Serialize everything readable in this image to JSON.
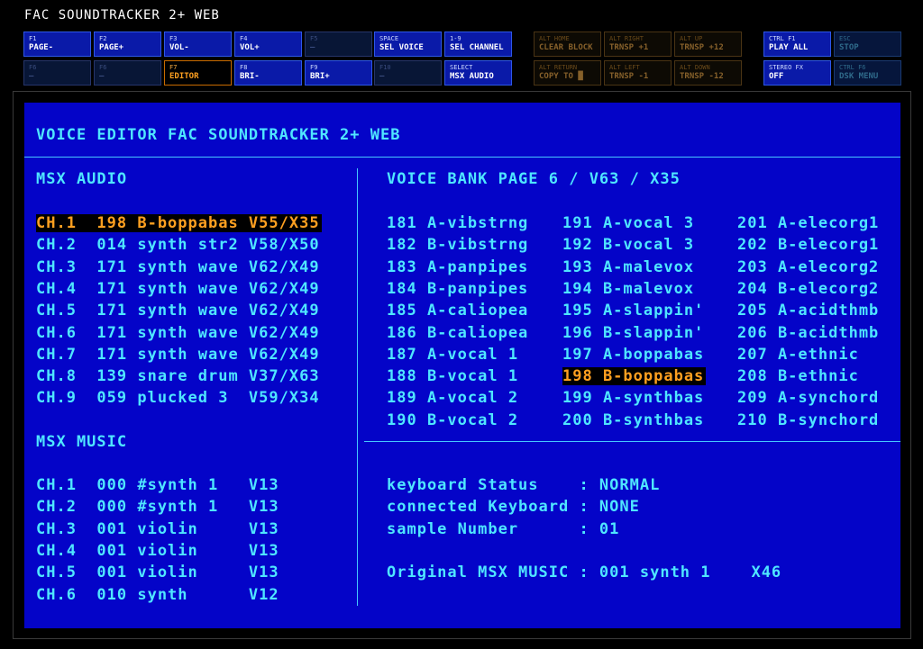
{
  "app_title": "FAC SOUNDTRACKER 2+ WEB",
  "keys_row1": [
    {
      "key": "F1",
      "label": "PAGE-"
    },
    {
      "key": "F2",
      "label": "PAGE+"
    },
    {
      "key": "F3",
      "label": "VOL-"
    },
    {
      "key": "F4",
      "label": "VOL+"
    },
    {
      "key": "F5",
      "label": "—"
    },
    {
      "key": "SPACE",
      "label": "SEL VOICE"
    },
    {
      "key": "1-9",
      "label": "SEL CHANNEL"
    },
    {
      "key": "ALT HOME",
      "label": "CLEAR BLOCK"
    },
    {
      "key": "ALT RIGHT",
      "label": "TRNSP +1"
    },
    {
      "key": "ALT UP",
      "label": "TRNSP +12"
    },
    {
      "key": "CTRL F1",
      "label": "PLAY ALL"
    },
    {
      "key": "ESC",
      "label": "STOP"
    }
  ],
  "keys_row2": [
    {
      "key": "F6",
      "label": "—"
    },
    {
      "key": "F6",
      "label": "—"
    },
    {
      "key": "F7",
      "label": "EDITOR"
    },
    {
      "key": "F8",
      "label": "BRI-"
    },
    {
      "key": "F9",
      "label": "BRI+"
    },
    {
      "key": "F10",
      "label": "—"
    },
    {
      "key": "SELECT",
      "label": "MSX AUDIO"
    },
    {
      "key": "ALT RETURN",
      "label": "COPY TO █"
    },
    {
      "key": "ALT LEFT",
      "label": "TRNSP -1"
    },
    {
      "key": "ALT DOWN",
      "label": "TRNSP -12"
    },
    {
      "key": "STEREO FX",
      "label": "OFF"
    },
    {
      "key": "CTRL F6",
      "label": "DSK MENU"
    }
  ],
  "editor": {
    "title": "VOICE EDITOR FAC SOUNDTRACKER 2+ WEB",
    "msx_audio": {
      "heading": "MSX AUDIO",
      "selected_index": 0,
      "channels": [
        "CH.1  198 B-boppabas V55/X35",
        "CH.2  014 synth str2 V58/X50",
        "CH.3  171 synth wave V62/X49",
        "CH.4  171 synth wave V62/X49",
        "CH.5  171 synth wave V62/X49",
        "CH.6  171 synth wave V62/X49",
        "CH.7  171 synth wave V62/X49",
        "CH.8  139 snare drum V37/X63",
        "CH.9  059 plucked 3  V59/X34"
      ]
    },
    "msx_music": {
      "heading": "MSX MUSIC",
      "channels": [
        "CH.1  000 #synth 1   V13",
        "CH.2  000 #synth 1   V13",
        "CH.3  001 violin     V13",
        "CH.4  001 violin     V13",
        "CH.5  001 violin     V13",
        "CH.6  010 synth      V12"
      ]
    },
    "voice_bank": {
      "heading": "VOICE BANK PAGE 6 / V63 / X35",
      "selected": "198 B-boppabas",
      "columns": [
        [
          "181 A-vibstrng",
          "182 B-vibstrng",
          "183 A-panpipes",
          "184 B-panpipes",
          "185 A-caliopea",
          "186 B-caliopea",
          "187 A-vocal 1",
          "188 B-vocal 1",
          "189 A-vocal 2",
          "190 B-vocal 2"
        ],
        [
          "191 A-vocal 3",
          "192 B-vocal 3",
          "193 A-malevox",
          "194 B-malevox",
          "195 A-slappin'",
          "196 B-slappin'",
          "197 A-boppabas",
          "198 B-boppabas",
          "199 A-synthbas",
          "200 B-synthbas"
        ],
        [
          "201 A-elecorg1",
          "202 B-elecorg1",
          "203 A-elecorg2",
          "204 B-elecorg2",
          "205 A-acidthmb",
          "206 B-acidthmb",
          "207 A-ethnic",
          "208 B-ethnic",
          "209 A-synchord",
          "210 B-synchord"
        ]
      ]
    },
    "status": {
      "lines": [
        "keyboard Status    : NORMAL",
        "connected Keyboard : NONE",
        "sample Number      : 01"
      ],
      "original": "Original MSX MUSIC : 001 synth 1    X46"
    }
  }
}
